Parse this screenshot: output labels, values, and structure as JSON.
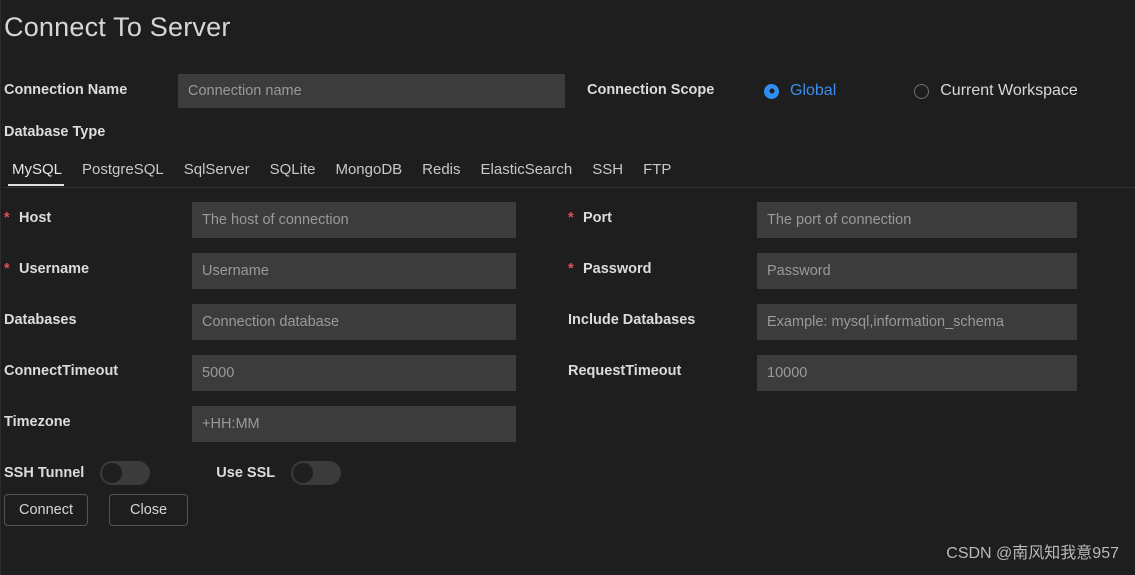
{
  "title": "Connect To Server",
  "connection": {
    "name_label": "Connection Name",
    "name_placeholder": "Connection name",
    "name_value": "",
    "scope_label": "Connection Scope",
    "scope_options": [
      {
        "label": "Global",
        "selected": true
      },
      {
        "label": "Current Workspace",
        "selected": false
      }
    ]
  },
  "database_type": {
    "label": "Database Type",
    "tabs": [
      {
        "label": "MySQL",
        "active": true
      },
      {
        "label": "PostgreSQL",
        "active": false
      },
      {
        "label": "SqlServer",
        "active": false
      },
      {
        "label": "SQLite",
        "active": false
      },
      {
        "label": "MongoDB",
        "active": false
      },
      {
        "label": "Redis",
        "active": false
      },
      {
        "label": "ElasticSearch",
        "active": false
      },
      {
        "label": "SSH",
        "active": false
      },
      {
        "label": "FTP",
        "active": false
      }
    ]
  },
  "form": {
    "required_marker": "*",
    "rows": [
      {
        "left": {
          "label": "Host",
          "required": true,
          "placeholder": "The host of connection",
          "value": ""
        },
        "right": {
          "label": "Port",
          "required": true,
          "placeholder": "The port of connection",
          "value": ""
        }
      },
      {
        "left": {
          "label": "Username",
          "required": true,
          "placeholder": "Username",
          "value": ""
        },
        "right": {
          "label": "Password",
          "required": true,
          "placeholder": "Password",
          "value": ""
        }
      },
      {
        "left": {
          "label": "Databases",
          "required": false,
          "placeholder": "Connection database",
          "value": ""
        },
        "right": {
          "label": "Include Databases",
          "required": false,
          "placeholder": "Example: mysql,information_schema",
          "value": ""
        }
      },
      {
        "left": {
          "label": "ConnectTimeout",
          "required": false,
          "placeholder": "5000",
          "value": ""
        },
        "right": {
          "label": "RequestTimeout",
          "required": false,
          "placeholder": "10000",
          "value": ""
        }
      },
      {
        "left": {
          "label": "Timezone",
          "required": false,
          "placeholder": "+HH:MM",
          "value": ""
        },
        "right": null
      }
    ]
  },
  "toggles": [
    {
      "label": "SSH Tunnel",
      "on": false
    },
    {
      "label": "Use SSL",
      "on": false
    }
  ],
  "buttons": {
    "connect": "Connect",
    "close": "Close"
  },
  "watermark": "CSDN @南风知我意957",
  "colors": {
    "background": "#1e1e1e",
    "input_background": "#3c3c3c",
    "accent": "#3b8eea",
    "required": "#e05252",
    "text": "#d6d6d6",
    "placeholder": "#9a9a9a"
  }
}
